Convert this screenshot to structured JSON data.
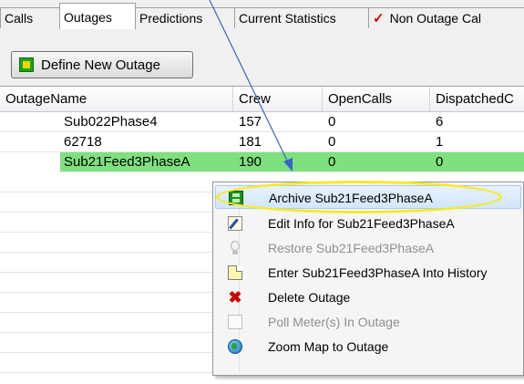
{
  "tabs": [
    {
      "label": "Calls"
    },
    {
      "label": "Outages"
    },
    {
      "label": "Predictions"
    },
    {
      "label": "Current Statistics"
    },
    {
      "label": "Non Outage Cal"
    }
  ],
  "toolbar": {
    "define_label": "Define New Outage"
  },
  "grid": {
    "headers": [
      "OutageName",
      "Crew",
      "OpenCalls",
      "DispatchedC"
    ],
    "rows": [
      {
        "name": "Sub022Phase4",
        "crew": "157",
        "open": "0",
        "dispatched": "6"
      },
      {
        "name": "62718",
        "crew": "181",
        "open": "0",
        "dispatched": "1"
      },
      {
        "name": "Sub21Feed3PhaseA",
        "crew": "190",
        "open": "0",
        "dispatched": "0"
      }
    ]
  },
  "menu": {
    "items": [
      {
        "label": "Archive Sub21Feed3PhaseA",
        "icon": "archive-icon",
        "enabled": true
      },
      {
        "label": "Edit Info for Sub21Feed3PhaseA",
        "icon": "edit-icon",
        "enabled": true
      },
      {
        "label": "Restore Sub21Feed3PhaseA",
        "icon": "bulb-icon",
        "enabled": false
      },
      {
        "label": "Enter Sub21Feed3PhaseA Into History",
        "icon": "document-icon",
        "enabled": true
      },
      {
        "label": "Delete Outage",
        "icon": "delete-x-icon",
        "enabled": true
      },
      {
        "label": "Poll Meter(s) In Outage",
        "icon": "meter-icon",
        "enabled": false
      },
      {
        "label": "Zoom Map to Outage",
        "icon": "globe-icon",
        "enabled": true
      }
    ]
  },
  "colors": {
    "selected_row": "#7fe07f",
    "highlight_ellipse": "#f5ea2a",
    "arrow": "#3b63c9"
  }
}
